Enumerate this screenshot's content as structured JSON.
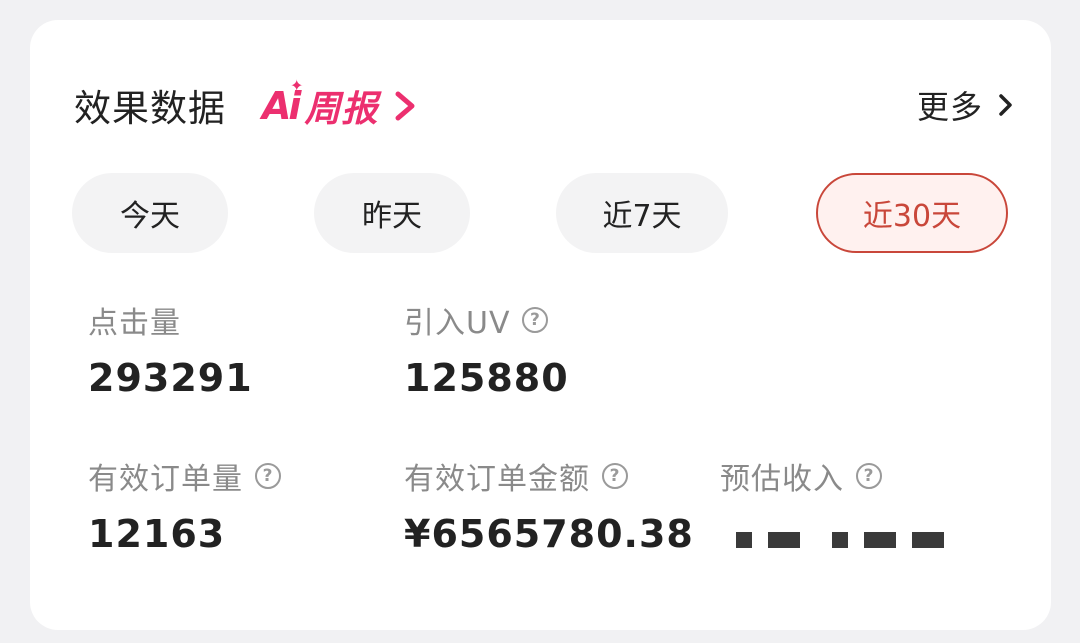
{
  "header": {
    "title": "效果数据",
    "ai_mark": "Ai",
    "ai_label": "周报",
    "more_label": "更多"
  },
  "tabs": [
    {
      "label": "今天",
      "active": false
    },
    {
      "label": "昨天",
      "active": false
    },
    {
      "label": "近7天",
      "active": false
    },
    {
      "label": "近30天",
      "active": true
    }
  ],
  "metrics": {
    "clicks": {
      "label": "点击量",
      "value": "293291"
    },
    "uv": {
      "label": "引入UV",
      "value": "125880",
      "help": "?"
    },
    "orders": {
      "label": "有效订单量",
      "value": "12163",
      "help": "?"
    },
    "order_amount": {
      "label": "有效订单金额",
      "value": "¥6565780.38",
      "help": "?"
    },
    "income": {
      "label": "预估收入",
      "help": "?",
      "value_redacted": true
    }
  },
  "colors": {
    "accent": "#c9473a",
    "accent_bg": "#fff1ef",
    "ai_brand": "#ec2f6f",
    "tab_bg": "#f3f3f4",
    "text": "#222222",
    "muted": "#8a8a8a"
  },
  "icons": [
    "chevron-right-icon",
    "help-circle-icon",
    "sparkle-icon"
  ]
}
